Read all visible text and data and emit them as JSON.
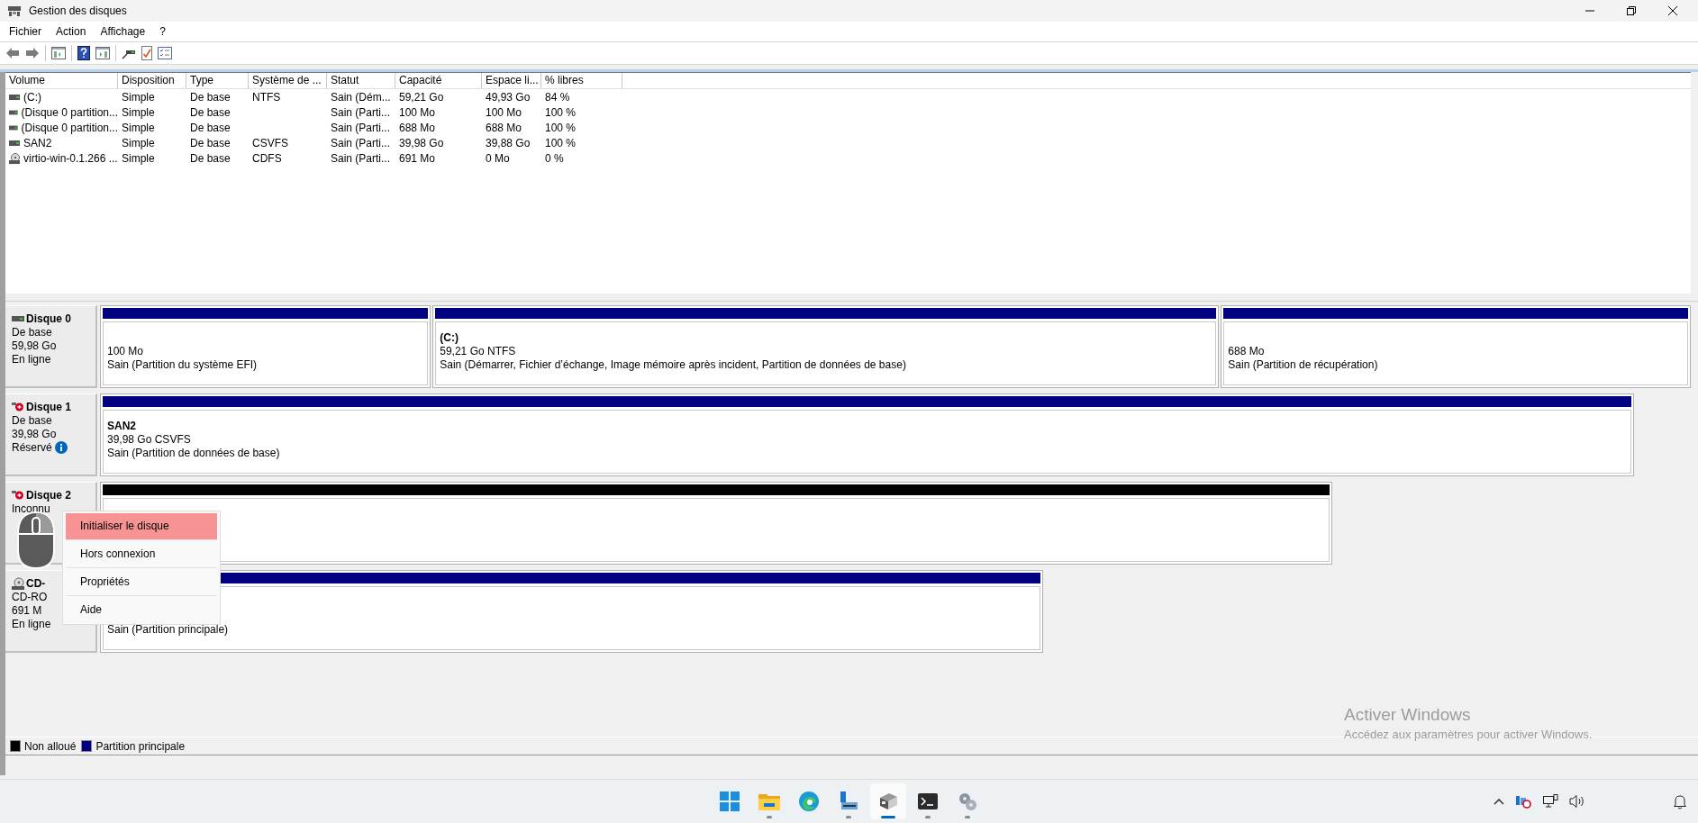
{
  "window": {
    "title": "Gestion des disques"
  },
  "menu": [
    "Fichier",
    "Action",
    "Affichage",
    "?"
  ],
  "volume_table": {
    "columns": [
      "Volume",
      "Disposition",
      "Type",
      "Système de ...",
      "Statut",
      "Capacité",
      "Espace li...",
      "% libres"
    ],
    "rows": [
      {
        "kind": "drive",
        "cells": [
          "(C:)",
          "Simple",
          "De base",
          "NTFS",
          "Sain (Dém...",
          "59,21 Go",
          "49,93 Go",
          "84 %"
        ]
      },
      {
        "kind": "drive",
        "cells": [
          "(Disque 0 partition...",
          "Simple",
          "De base",
          "",
          "Sain (Parti...",
          "100 Mo",
          "100 Mo",
          "100 %"
        ]
      },
      {
        "kind": "drive",
        "cells": [
          "(Disque 0 partition...",
          "Simple",
          "De base",
          "",
          "Sain (Parti...",
          "688 Mo",
          "688 Mo",
          "100 %"
        ]
      },
      {
        "kind": "drive",
        "cells": [
          "SAN2",
          "Simple",
          "De base",
          "CSVFS",
          "Sain (Parti...",
          "39,98 Go",
          "39,88 Go",
          "100 %"
        ]
      },
      {
        "kind": "cd",
        "cells": [
          "virtio-win-0.1.266 ...",
          "Simple",
          "De base",
          "CDFS",
          "Sain (Parti...",
          "691 Mo",
          "0 Mo",
          "0 %"
        ]
      }
    ]
  },
  "disks": [
    {
      "kind": "drive",
      "name": "Disque 0",
      "details": [
        {
          "text": "De base",
          "info": false
        },
        {
          "text": "59,98 Go",
          "info": false
        },
        {
          "text": "En ligne",
          "info": false
        }
      ],
      "partitions": [
        {
          "kind": "primary",
          "lines": [
            "100 Mo",
            "Sain (Partition du système EFI)"
          ]
        },
        {
          "kind": "primary",
          "title": "(C:)",
          "lines": [
            "59,21 Go NTFS",
            "Sain (Démarrer, Fichier d’échange, Image mémoire après incident, Partition de données de base)"
          ]
        },
        {
          "kind": "primary",
          "lines": [
            "688 Mo",
            "Sain (Partition de récupération)"
          ]
        }
      ]
    },
    {
      "kind": "drive-error",
      "name": "Disque 1",
      "details": [
        {
          "text": "De base",
          "info": false
        },
        {
          "text": "39,98 Go",
          "info": false
        },
        {
          "text": "Réservé",
          "info": true
        }
      ],
      "partitions": [
        {
          "kind": "primary",
          "title": "SAN2",
          "lines": [
            "39,98 Go CSVFS",
            "Sain (Partition de données de base)"
          ]
        }
      ]
    },
    {
      "kind": "drive-error",
      "name": "Disque 2",
      "details": [
        {
          "text": "Inconnu",
          "info": false
        }
      ],
      "partitions": [
        {
          "kind": "unallocated"
        }
      ]
    },
    {
      "kind": "cd",
      "name": "CD-",
      "details": [
        {
          "text": "CD-RO",
          "info": false
        },
        {
          "text": "691 M",
          "info": false
        },
        {
          "text": "En ligne",
          "info": false
        }
      ],
      "partitions": [
        {
          "kind": "primary",
          "lines": [
            "Sain (Partition principale)"
          ]
        }
      ]
    }
  ],
  "legend": [
    {
      "label": "Non alloué",
      "color": "#000000"
    },
    {
      "label": "Partition principale",
      "color": "#000080"
    }
  ],
  "context_menu": [
    {
      "label": "Initialiser le disque",
      "selected": true
    },
    {
      "label": "Hors connexion",
      "selected": false
    },
    {
      "label": "Propriétés",
      "selected": false
    },
    {
      "label": "Aide",
      "selected": false
    }
  ],
  "activation_notice": {
    "title": "Activer Windows",
    "text": "Accédez aux paramètres pour activer Windows."
  },
  "taskbar": {
    "apps": [
      {
        "kind": "start",
        "running": false,
        "active": false
      },
      {
        "kind": "folder",
        "running": true,
        "active": false
      },
      {
        "kind": "browser",
        "running": false,
        "active": false
      },
      {
        "kind": "server",
        "running": true,
        "active": false
      },
      {
        "kind": "disk",
        "running": true,
        "active": true
      },
      {
        "kind": "terminal",
        "running": true,
        "active": false
      },
      {
        "kind": "gears",
        "running": true,
        "active": false
      }
    ],
    "tray": [
      {
        "kind": "chevron"
      },
      {
        "kind": "network-alert"
      },
      {
        "kind": "network"
      },
      {
        "kind": "speaker"
      },
      {
        "kind": "bell"
      }
    ]
  }
}
